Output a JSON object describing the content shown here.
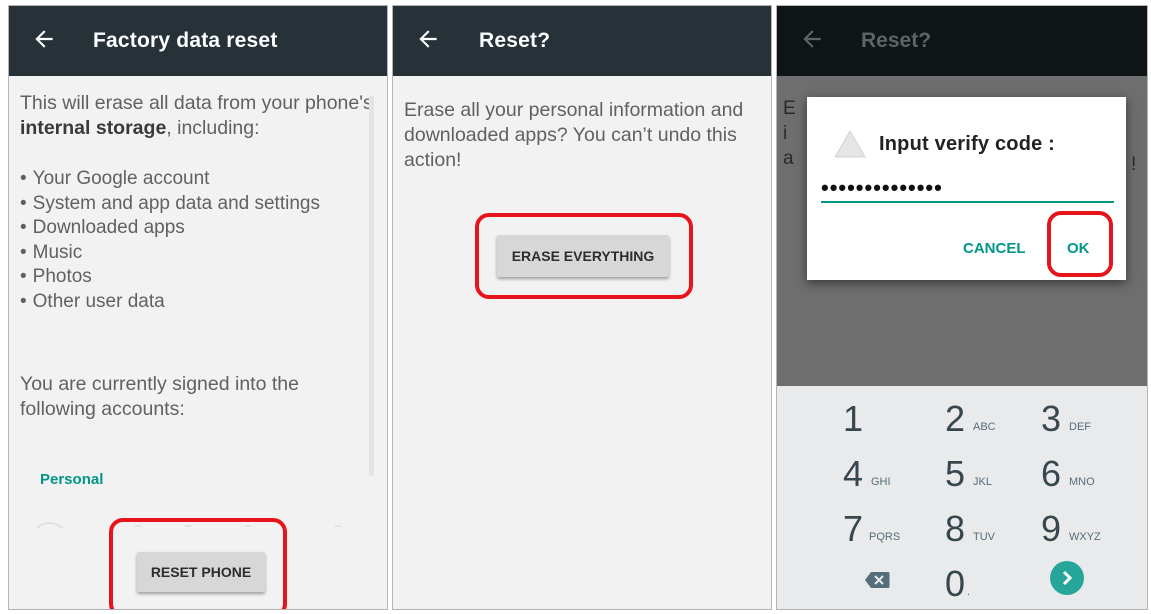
{
  "panel1": {
    "title": "Factory data reset",
    "intro_prefix": "This will erase all data from your phone's ",
    "intro_bold": "internal storage",
    "intro_suffix": ", including:",
    "items": [
      "Your Google account",
      "System and app data and settings",
      "Downloaded apps",
      "Music",
      "Photos",
      "Other user data"
    ],
    "accounts_text": "You are currently signed into the following accounts:",
    "section_label": "Personal",
    "reset_button": "RESET PHONE"
  },
  "panel2": {
    "title": "Reset?",
    "message": "Erase all your personal information and downloaded apps? You can’t undo this action!",
    "erase_button": "ERASE EVERYTHING"
  },
  "panel3": {
    "title": "Reset?",
    "dialog": {
      "title": "Input verify code :",
      "code": "••••••••••••••",
      "cancel": "CANCEL",
      "ok": "OK"
    },
    "keys": [
      {
        "num": "1",
        "letters": ""
      },
      {
        "num": "2",
        "letters": "ABC"
      },
      {
        "num": "3",
        "letters": "DEF"
      },
      {
        "num": "4",
        "letters": "GHI"
      },
      {
        "num": "5",
        "letters": "JKL"
      },
      {
        "num": "6",
        "letters": "MNO"
      },
      {
        "num": "7",
        "letters": "PQRS"
      },
      {
        "num": "8",
        "letters": "TUV"
      },
      {
        "num": "9",
        "letters": "WXYZ"
      },
      {
        "num": "0",
        "letters": "."
      }
    ]
  },
  "colors": {
    "appbar": "#263238",
    "accent": "#009688",
    "highlight": "#e8141b",
    "enter_key": "#26a69a"
  },
  "icons": [
    "back-arrow-icon",
    "warning-icon",
    "backspace-icon",
    "go-arrow-icon"
  ]
}
